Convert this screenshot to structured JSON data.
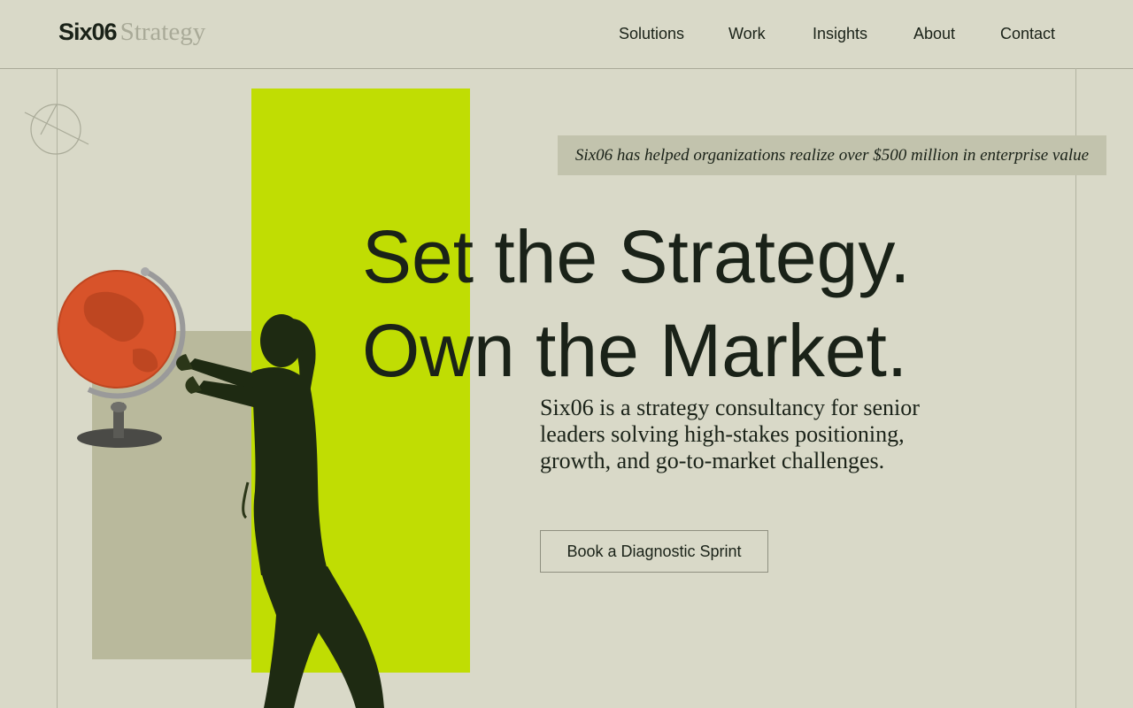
{
  "brand": {
    "logo_main": "Six06",
    "logo_sub": "Strategy"
  },
  "nav": {
    "items": [
      {
        "label": "Solutions"
      },
      {
        "label": "Work"
      },
      {
        "label": "Insights"
      },
      {
        "label": "About"
      },
      {
        "label": "Contact"
      }
    ]
  },
  "hero": {
    "stat_banner": "Six06 has helped organizations realize over $500 million in enterprise value",
    "headline_line1": "Set the Strategy.",
    "headline_line2": "Own the Market.",
    "description": "Six06 is a strategy consultancy for senior leaders solving high-stakes positioning, growth, and go-to-market challenges.",
    "cta_label": "Book a Diagnostic Sprint"
  },
  "colors": {
    "background": "#d9d9c8",
    "accent_lime": "#c0dd03",
    "olive_block": "#b9b99c",
    "text_dark": "#1a2218",
    "globe_orange": "#d8532a"
  },
  "imagery": {
    "figure": "person-holding-globe-illustration",
    "decoration": "crossed-circle-icon"
  }
}
